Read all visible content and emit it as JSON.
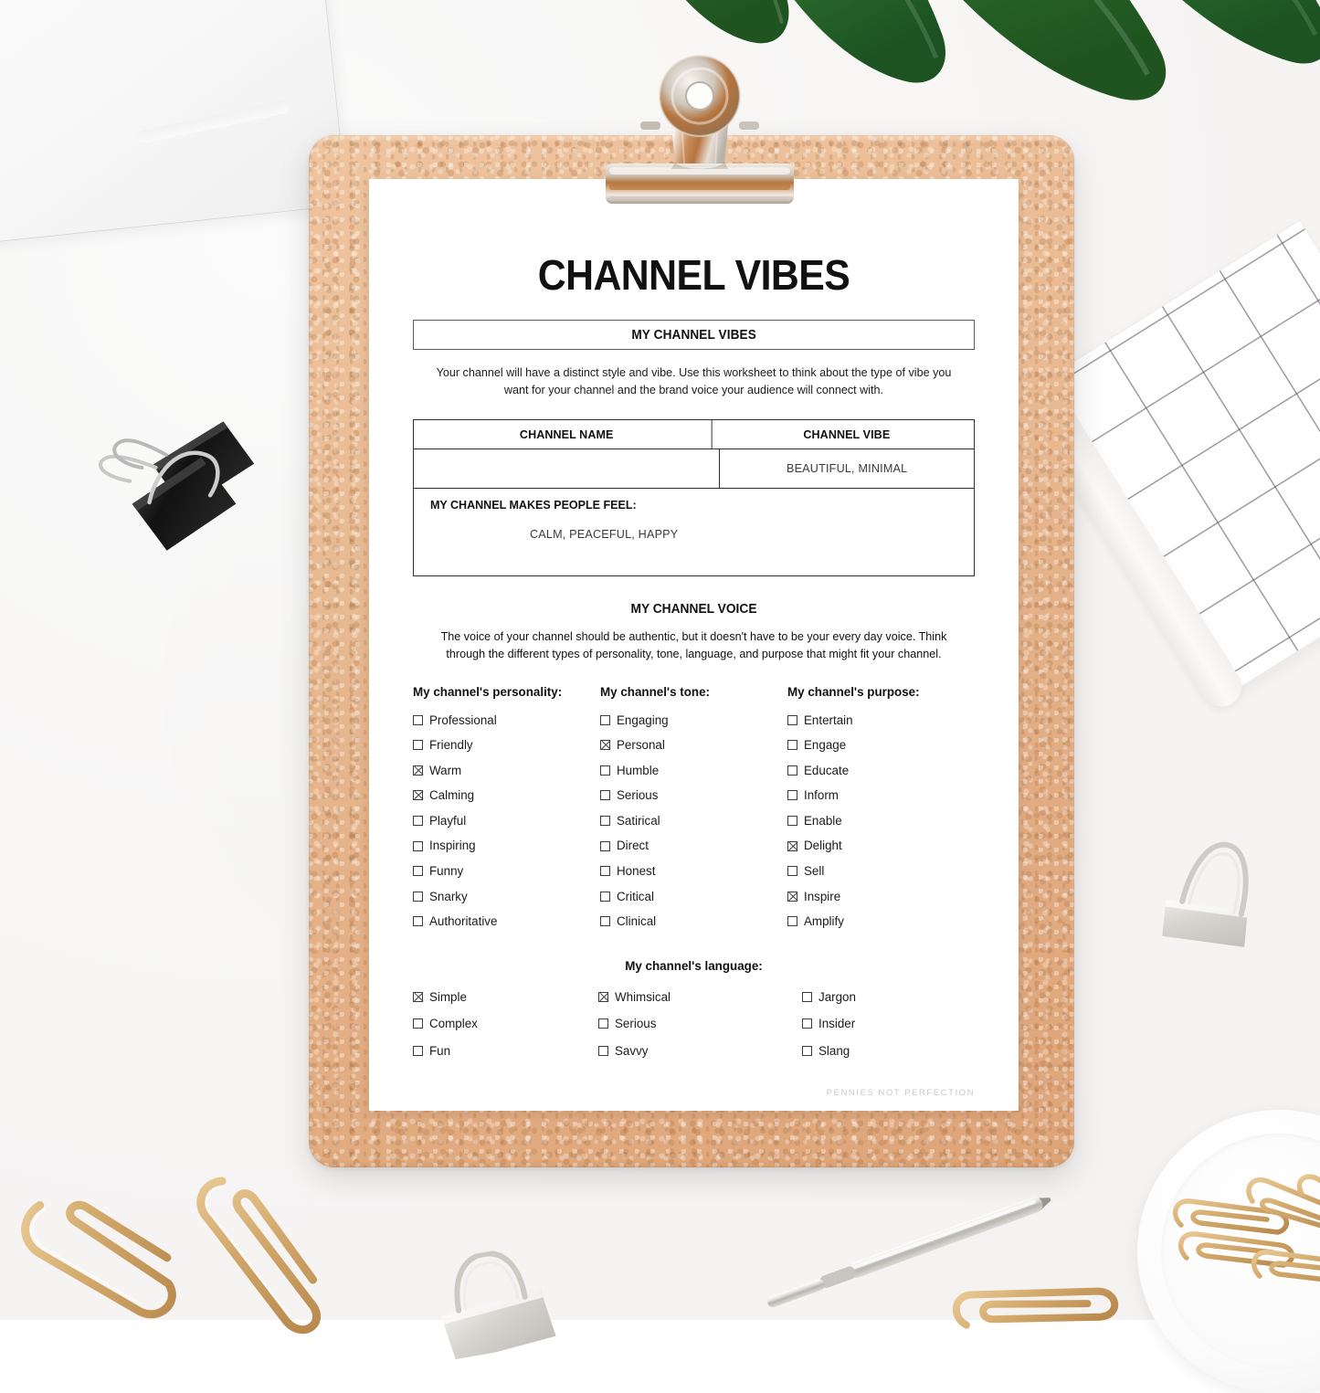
{
  "document": {
    "title": "CHANNEL VIBES",
    "section_bar_label": "MY CHANNEL VIBES",
    "intro": "Your channel will have a distinct style and vibe. Use this worksheet to think about the type of vibe you want for your channel and the brand voice your audience will connect with.",
    "footer": "PENNIES NOT PERFECTION"
  },
  "vibes_table": {
    "header_left": "CHANNEL NAME",
    "header_right": "CHANNEL VIBE",
    "value_left": "",
    "value_right": "BEAUTIFUL, MINIMAL",
    "feel_label": "MY CHANNEL MAKES PEOPLE FEEL:",
    "feel_value": "CALM, PEACEFUL, HAPPY"
  },
  "voice": {
    "heading": "MY CHANNEL VOICE",
    "intro": "The voice of your channel should be authentic, but it doesn't have to be your every day voice. Think through the different types of personality, tone, language, and purpose that might fit your channel.",
    "columns": [
      {
        "title": "My channel's personality:",
        "options": [
          {
            "label": "Professional",
            "checked": false
          },
          {
            "label": "Friendly",
            "checked": false
          },
          {
            "label": "Warm",
            "checked": true
          },
          {
            "label": "Calming",
            "checked": true
          },
          {
            "label": "Playful",
            "checked": false
          },
          {
            "label": "Inspiring",
            "checked": false
          },
          {
            "label": "Funny",
            "checked": false
          },
          {
            "label": "Snarky",
            "checked": false
          },
          {
            "label": "Authoritative",
            "checked": false
          }
        ]
      },
      {
        "title": "My channel's tone:",
        "options": [
          {
            "label": "Engaging",
            "checked": false
          },
          {
            "label": "Personal",
            "checked": true
          },
          {
            "label": "Humble",
            "checked": false
          },
          {
            "label": "Serious",
            "checked": false
          },
          {
            "label": "Satirical",
            "checked": false
          },
          {
            "label": "Direct",
            "checked": false
          },
          {
            "label": "Honest",
            "checked": false
          },
          {
            "label": "Critical",
            "checked": false
          },
          {
            "label": "Clinical",
            "checked": false
          }
        ]
      },
      {
        "title": "My channel's purpose:",
        "options": [
          {
            "label": "Entertain",
            "checked": false
          },
          {
            "label": "Engage",
            "checked": false
          },
          {
            "label": "Educate",
            "checked": false
          },
          {
            "label": "Inform",
            "checked": false
          },
          {
            "label": "Enable",
            "checked": false
          },
          {
            "label": "Delight",
            "checked": true
          },
          {
            "label": "Sell",
            "checked": false
          },
          {
            "label": "Inspire",
            "checked": true
          },
          {
            "label": "Amplify",
            "checked": false
          }
        ]
      }
    ],
    "language": {
      "title": "My channel's language:",
      "columns": [
        [
          {
            "label": "Simple",
            "checked": true
          },
          {
            "label": "Complex",
            "checked": false
          },
          {
            "label": "Fun",
            "checked": false
          }
        ],
        [
          {
            "label": "Whimsical",
            "checked": true
          },
          {
            "label": "Serious",
            "checked": false
          },
          {
            "label": "Savvy",
            "checked": false
          }
        ],
        [
          {
            "label": "Jargon",
            "checked": false
          },
          {
            "label": "Insider",
            "checked": false
          },
          {
            "label": "Slang",
            "checked": false
          }
        ]
      ]
    }
  },
  "desk_objects": {
    "laptop": "laptop-corner",
    "leaf": "monstera-leaf",
    "black_clips": "black-binder-clips",
    "silver_clip": "silver-binder-clip",
    "notebook": "grid-notebook",
    "dish": "ceramic-dish",
    "gold_clips": "gold-paper-clips",
    "pen": "silver-pen"
  },
  "colors": {
    "cork": "#e9ba92",
    "paper": "#ffffff",
    "ink": "#111111",
    "leaf_green": "#2d6b2a",
    "gold": "#d9b27c",
    "footer_gray": "#c9c9c9"
  }
}
